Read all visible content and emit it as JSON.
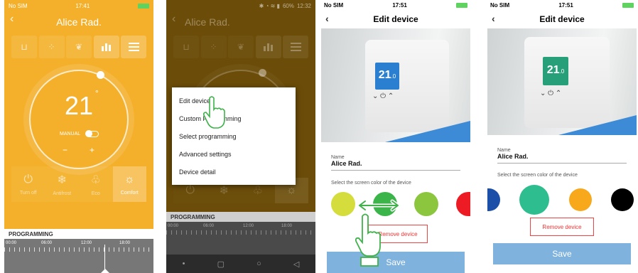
{
  "phone1": {
    "status": {
      "carrier": "No SIM",
      "time": "17:41"
    },
    "title": "Alice Rad.",
    "temperature": "21",
    "degree": "°",
    "mode_label": "MANUAL",
    "minus": "−",
    "plus": "+",
    "presets": [
      {
        "label": "Turn off",
        "icon": "power-icon"
      },
      {
        "label": "Antifrost",
        "icon": "snowflake-icon"
      },
      {
        "label": "Eco",
        "icon": "eco-icon"
      },
      {
        "label": "Comfort",
        "icon": "sun-icon"
      }
    ],
    "programming_label": "PROGRAMMING",
    "timeline_labels": [
      "00:00",
      "06:00",
      "12:00",
      "18:00"
    ]
  },
  "phone2": {
    "status": {
      "right": "60%",
      "time": "12:32"
    },
    "title": "Alice Rad.",
    "menu_items": [
      "Edit device",
      "Custom Programming",
      "Select programming",
      "Advanced settings",
      "Device detail"
    ],
    "programming_label": "PROGRAMMING",
    "timeline_labels": [
      "00:00",
      "06:00",
      "12:00",
      "18:00"
    ]
  },
  "phone3": {
    "status": {
      "carrier": "No SIM",
      "time": "17:51"
    },
    "title": "Edit device",
    "device_screen_value": "21",
    "device_screen_decimal": ".0",
    "name_label": "Name",
    "name_value": "Alice Rad.",
    "color_prompt": "Select the screen color of the device",
    "colors": [
      "#d4dd3c",
      "#3bb54a",
      "#8cc63f",
      "#ed1c24"
    ],
    "remove_label": "Remove device",
    "save_label": "Save"
  },
  "phone4": {
    "status": {
      "carrier": "No SIM",
      "time": "17:51"
    },
    "title": "Edit device",
    "device_screen_value": "21",
    "device_screen_decimal": ".0",
    "name_label": "Name",
    "name_value": "Alice Rad.",
    "color_prompt": "Select the screen color of the device",
    "colors": [
      "#1b4fa8",
      "#2ebd8f",
      "#f7a81b",
      "#000000"
    ],
    "remove_label": "Remove device",
    "save_label": "Save"
  }
}
